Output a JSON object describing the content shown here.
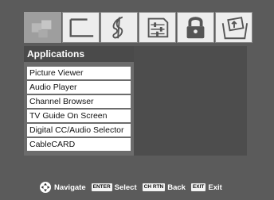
{
  "menu": {
    "title": "Applications",
    "items": [
      "Picture Viewer",
      "Audio Player",
      "Channel Browser",
      "TV Guide On Screen",
      "Digital CC/Audio Selector",
      "CableCARD"
    ]
  },
  "tabs": [
    {
      "icon": "applications-icon",
      "selected": true
    },
    {
      "icon": "picture-icon",
      "selected": false
    },
    {
      "icon": "audio-icon",
      "selected": false
    },
    {
      "icon": "setup-icon",
      "selected": false
    },
    {
      "icon": "lock-icon",
      "selected": false
    },
    {
      "icon": "preferences-icon",
      "selected": false
    }
  ],
  "footer": {
    "navigate_label": "Navigate",
    "enter_key": "ENTER",
    "select_label": "Select",
    "chrtn_key": "CH RTN",
    "back_label": "Back",
    "exit_key": "EXIT",
    "exit_label": "Exit"
  }
}
